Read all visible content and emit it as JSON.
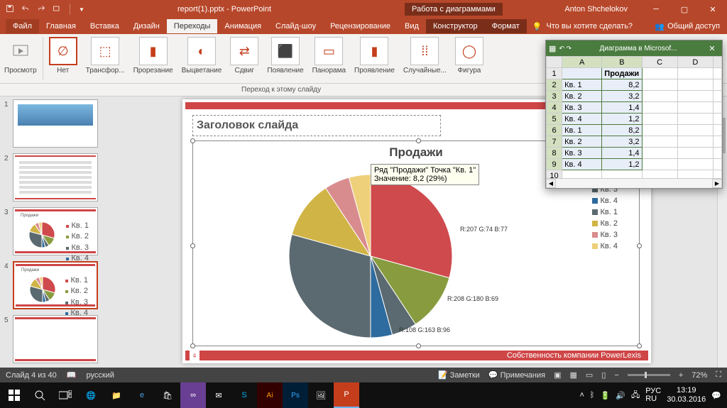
{
  "titlebar": {
    "doc_title": "report(1).pptx - PowerPoint",
    "context_title": "Работа с диаграммами",
    "user": "Anton Shchelokov"
  },
  "tabs": {
    "file": "Файл",
    "items": [
      "Главная",
      "Вставка",
      "Дизайн",
      "Переходы",
      "Анимация",
      "Слайд-шоу",
      "Рецензирование",
      "Вид",
      "Конструктор",
      "Формат"
    ],
    "active": "Переходы",
    "tellme": "Что вы хотите сделать?",
    "share": "Общий доступ"
  },
  "ribbon": {
    "preview": "Просмотр",
    "transitions": [
      "Нет",
      "Трансфор...",
      "Прорезание",
      "Выцветание",
      "Сдвиг",
      "Появление",
      "Панорама",
      "Проявление",
      "Случайные...",
      "Фигура"
    ],
    "subtitle": "Переход к этому слайду"
  },
  "thumbs": [
    {
      "num": "1"
    },
    {
      "num": "2"
    },
    {
      "num": "3"
    },
    {
      "num": "4",
      "sel": true
    },
    {
      "num": "5"
    }
  ],
  "slide": {
    "title_placeholder": "Заголовок слайда",
    "chart_title": "Продажи",
    "page_num": "4",
    "footer": "Собственность компании PowerLexis",
    "tooltip_l1": "Ряд \"Продажи\" Точка \"Кв. 1\"",
    "tooltip_l2": "Значение: 8,2 (29%)",
    "rgb1": "R:207\nG:74\nB:77",
    "rgb2": "R:208\nG:180\nB:69",
    "rgb3": "R:108\nG:163\nB:96"
  },
  "legend_items": [
    "Кв. 1",
    "Кв. 2",
    "Кв. 3",
    "Кв. 4",
    "Кв. 1",
    "Кв. 2",
    "Кв. 3",
    "Кв. 4"
  ],
  "legend_colors": [
    "#cf4a4d",
    "#889c3f",
    "#5b6a70",
    "#2e6b9e",
    "#5b6a70",
    "#d0b445",
    "#d98c8e",
    "#eed07a"
  ],
  "excel": {
    "title": "Диаграмма в Microsof...",
    "header": [
      "",
      "A",
      "B",
      "C",
      "D"
    ],
    "b1": "Продажи",
    "rows": [
      {
        "n": "2",
        "a": "Кв. 1",
        "b": "8,2"
      },
      {
        "n": "3",
        "a": "Кв. 2",
        "b": "3,2"
      },
      {
        "n": "4",
        "a": "Кв. 3",
        "b": "1,4"
      },
      {
        "n": "5",
        "a": "Кв. 4",
        "b": "1,2"
      },
      {
        "n": "6",
        "a": "Кв. 1",
        "b": "8,2"
      },
      {
        "n": "7",
        "a": "Кв. 2",
        "b": "3,2"
      },
      {
        "n": "8",
        "a": "Кв. 3",
        "b": "1,4"
      },
      {
        "n": "9",
        "a": "Кв. 4",
        "b": "1,2"
      }
    ]
  },
  "statusbar": {
    "slide": "Слайд 4 из 40",
    "lang": "русский",
    "notes": "Заметки",
    "comments": "Примечания",
    "zoom": "72%"
  },
  "taskbar": {
    "tray_lang": "РУС\nRU",
    "time": "13:19",
    "date": "30.03.2016"
  },
  "chart_data": {
    "type": "pie",
    "title": "Продажи",
    "categories": [
      "Кв. 1",
      "Кв. 2",
      "Кв. 3",
      "Кв. 4",
      "Кв. 1",
      "Кв. 2",
      "Кв. 3",
      "Кв. 4"
    ],
    "values": [
      8.2,
      3.2,
      1.4,
      1.2,
      8.2,
      3.2,
      1.4,
      1.2
    ],
    "colors": [
      "#cf4a4d",
      "#889c3f",
      "#5b6a70",
      "#2e6b9e",
      "#5b6a70",
      "#d0b445",
      "#d98c8e",
      "#eed07a"
    ]
  }
}
